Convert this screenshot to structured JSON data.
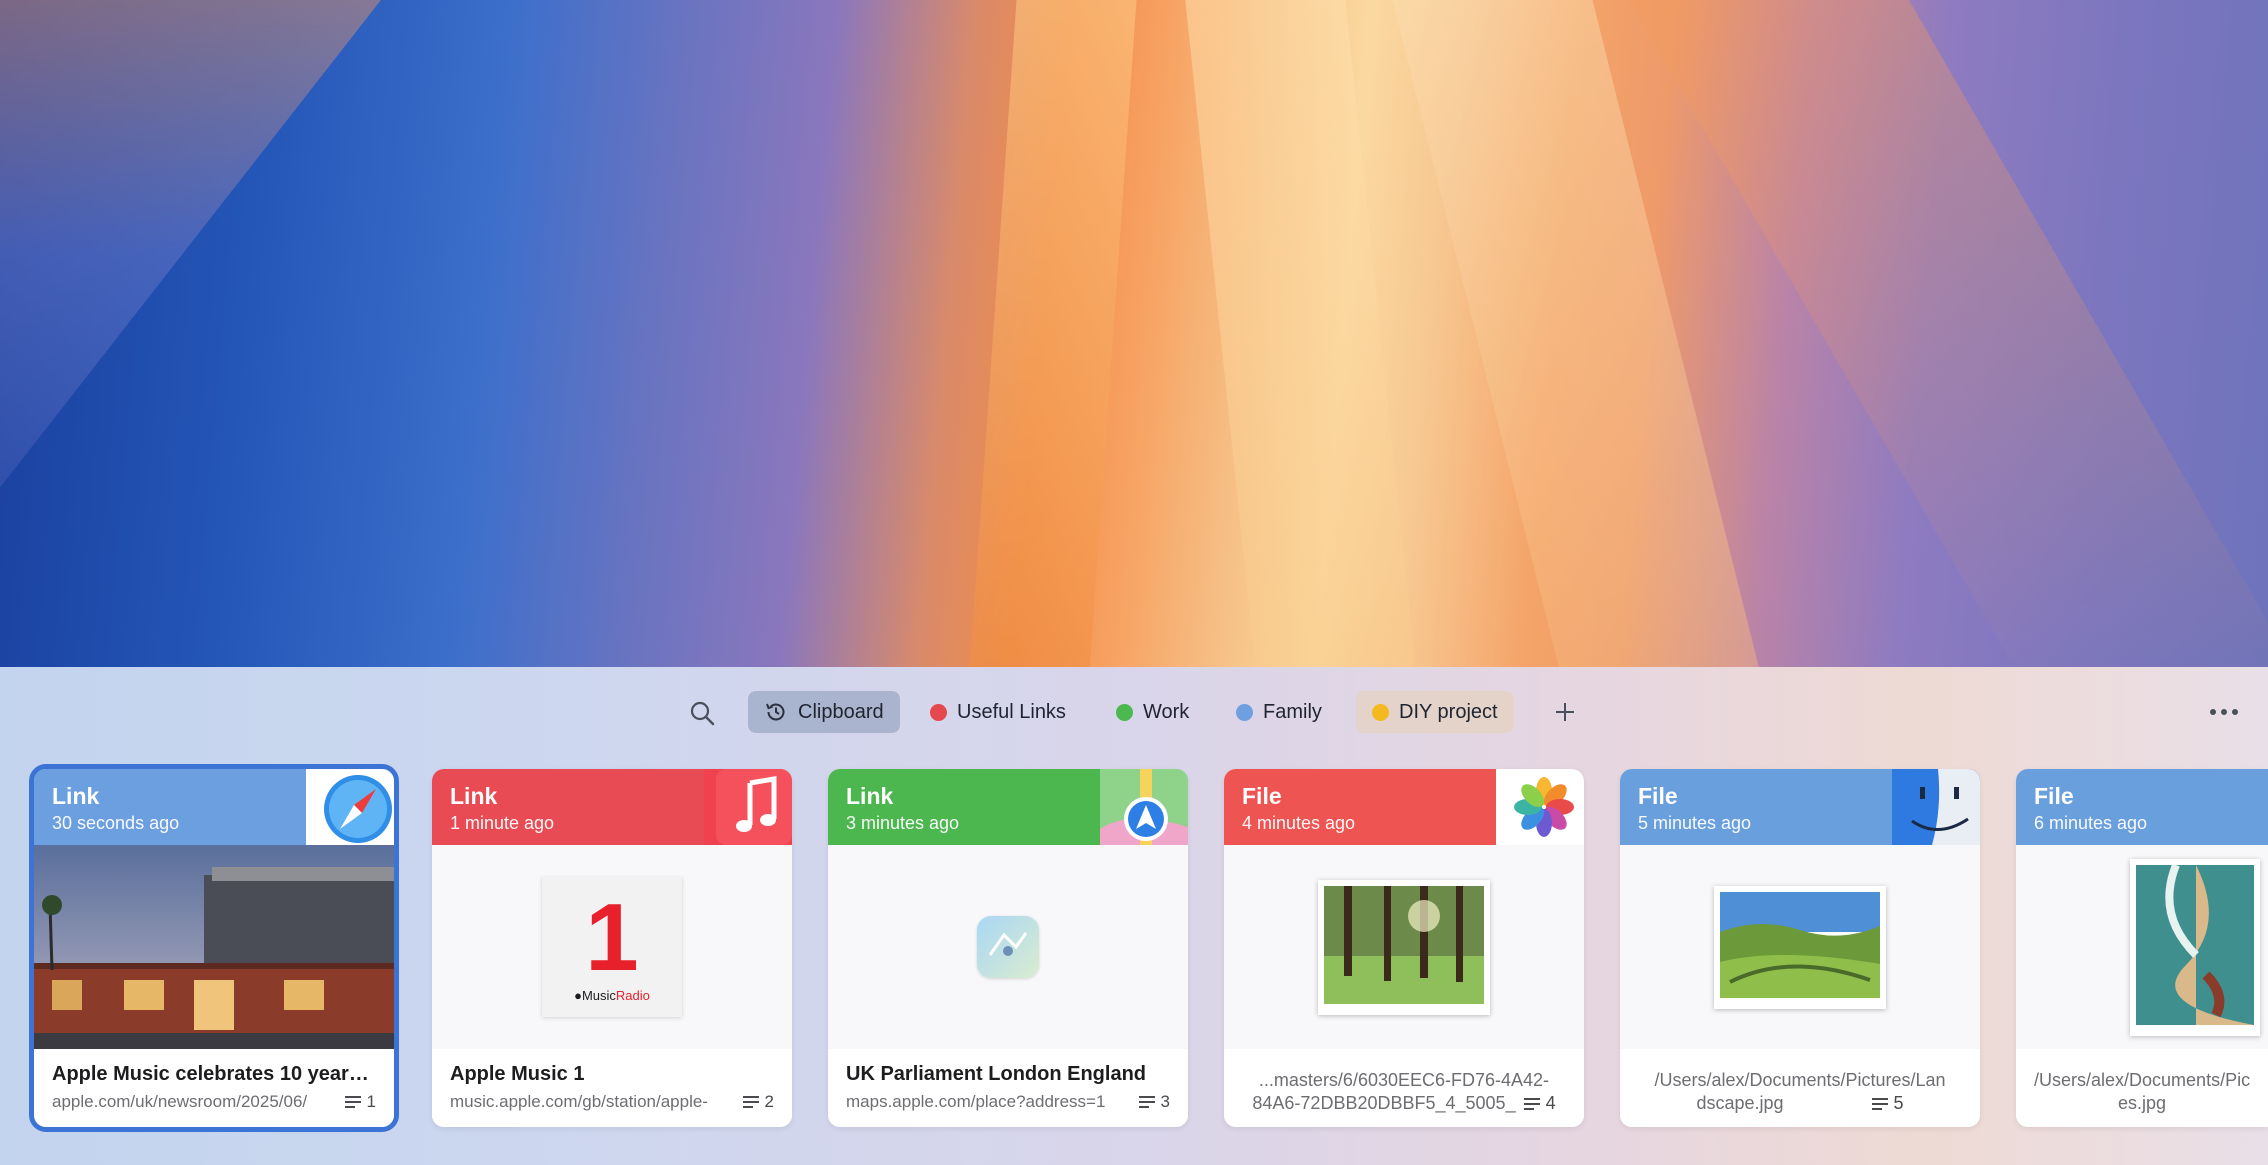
{
  "toolbar": {
    "search_icon": "magnifier-icon",
    "tabs": [
      {
        "label": "Clipboard",
        "icon": "history-clock-icon",
        "active": true
      },
      {
        "label": "Useful Links",
        "color": "#e5484d"
      },
      {
        "label": "Work",
        "color": "#4cb850"
      },
      {
        "label": "Family",
        "color": "#6ea0e0"
      },
      {
        "label": "DIY project",
        "color": "#f4b921"
      }
    ],
    "add_icon": "plus-icon",
    "more_icon": "ellipsis-icon"
  },
  "colors": {
    "link_blue": "#6b9fe0",
    "link_red": "#e94b55",
    "link_green": "#4cb64f",
    "file_red": "#ee5451",
    "file_blue": "#6a9fde",
    "selection": "#3c74d6"
  },
  "cards": [
    {
      "type": "Link",
      "time": "30 seconds ago",
      "app_icon": "safari-icon",
      "title": "Apple Music celebrates 10 years...",
      "url": "apple.com/uk/newsroom/2025/06/",
      "count": "1"
    },
    {
      "type": "Link",
      "time": "1 minute ago",
      "app_icon": "music-icon",
      "title": "Apple Music 1",
      "url": "music.apple.com/gb/station/apple-",
      "count": "2",
      "preview_number": "1",
      "preview_brand": "Music",
      "preview_brand_accent": "Radio"
    },
    {
      "type": "Link",
      "time": "3 minutes ago",
      "app_icon": "maps-icon",
      "title": "UK Parliament London England",
      "url": "maps.apple.com/place?address=1",
      "count": "3"
    },
    {
      "type": "File",
      "time": "4 minutes ago",
      "app_icon": "photos-icon",
      "path_line1": "...masters/6/6030EEC6-FD76-4A42-",
      "path_line2": "84A6-72DBB20DBBF5_4_5005_",
      "count": "4"
    },
    {
      "type": "File",
      "time": "5 minutes ago",
      "app_icon": "finder-icon",
      "path_line1": "/Users/alex/Documents/Pictures/Lan",
      "path_line2": "dscape.jpg",
      "count": "5"
    },
    {
      "type": "File",
      "time": "6 minutes ago",
      "app_icon": "finder-icon",
      "path_line1": "/Users/alex/Documents/Pic",
      "path_line2": "es.jpg"
    }
  ]
}
